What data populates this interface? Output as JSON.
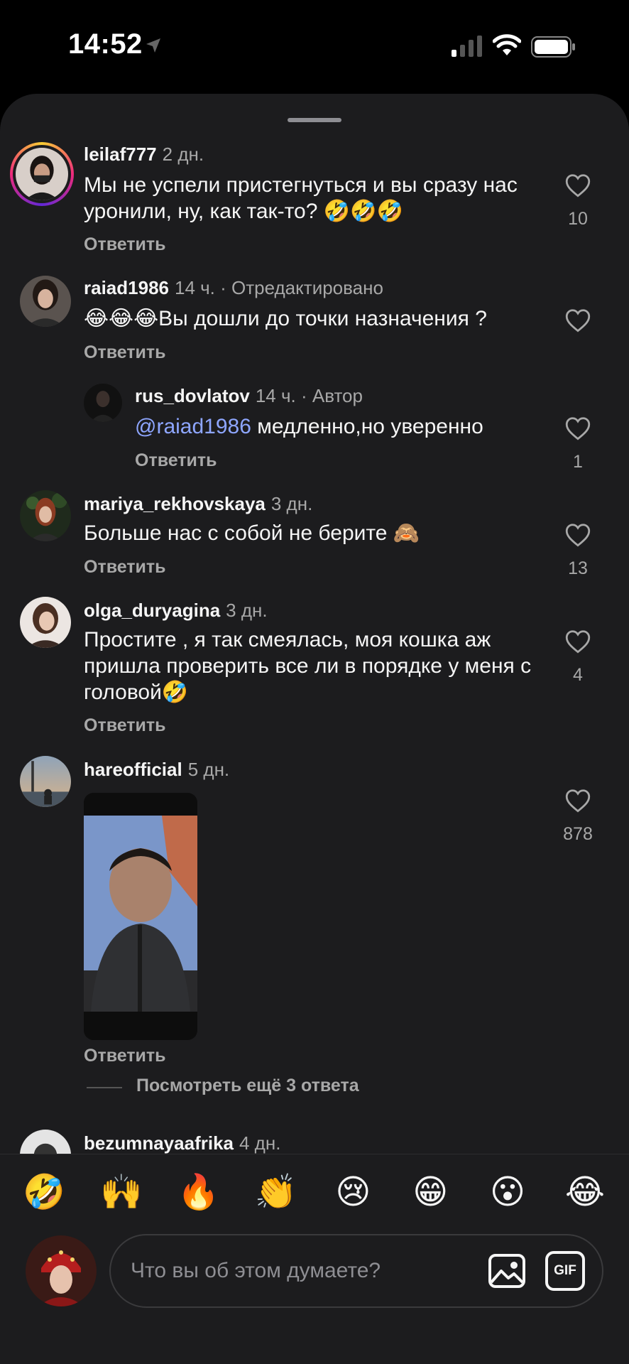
{
  "status_bar": {
    "time": "14:52"
  },
  "comments": [
    {
      "username": "leilaf777",
      "time": "2 дн.",
      "suffix": "",
      "text": "Мы не успели пристегнуться и вы сразу нас уронили, ну, как так-то? 🤣🤣🤣",
      "likes": "10",
      "reply_label": "Ответить"
    },
    {
      "username": "raiad1986",
      "time": "14 ч.",
      "suffix": " · Отредактировано",
      "text": "😂😂😂Вы дошли до точки назначения ?",
      "likes": "",
      "reply_label": "Ответить"
    },
    {
      "username": "rus_dovlatov",
      "time": "14 ч.",
      "suffix": " · Автор",
      "mention": "@raiad1986",
      "text": " медленно,но уверенно",
      "likes": "1",
      "reply_label": "Ответить"
    },
    {
      "username": "mariya_rekhovskaya",
      "time": "3 дн.",
      "suffix": "",
      "text": "Больше нас с собой не берите 🙈",
      "likes": "13",
      "reply_label": "Ответить"
    },
    {
      "username": "olga_duryagina",
      "time": "3 дн.",
      "suffix": "",
      "text": "Простите , я так смеялась, моя кошка аж пришла проверить все ли в порядке у меня с головой🤣",
      "likes": "4",
      "reply_label": "Ответить"
    },
    {
      "username": "hareofficial",
      "time": "5 дн.",
      "suffix": "",
      "text": "",
      "likes": "878",
      "reply_label": "Ответить"
    },
    {
      "username": "bezumnayaafrika",
      "time": "4 дн.",
      "suffix": ""
    }
  ],
  "view_more_replies": "Посмотреть ещё 3 ответа",
  "composer": {
    "emojis": [
      "🤣",
      "🙌",
      "🔥",
      "👏",
      "😢",
      "😁",
      "😮",
      "😂"
    ],
    "placeholder": "Что вы об этом думаете?",
    "gif_label": "GIF"
  },
  "colors": {
    "background": "#1c1c1e",
    "mention": "#8ea6ff",
    "secondary_text": "#a8a8a8"
  }
}
